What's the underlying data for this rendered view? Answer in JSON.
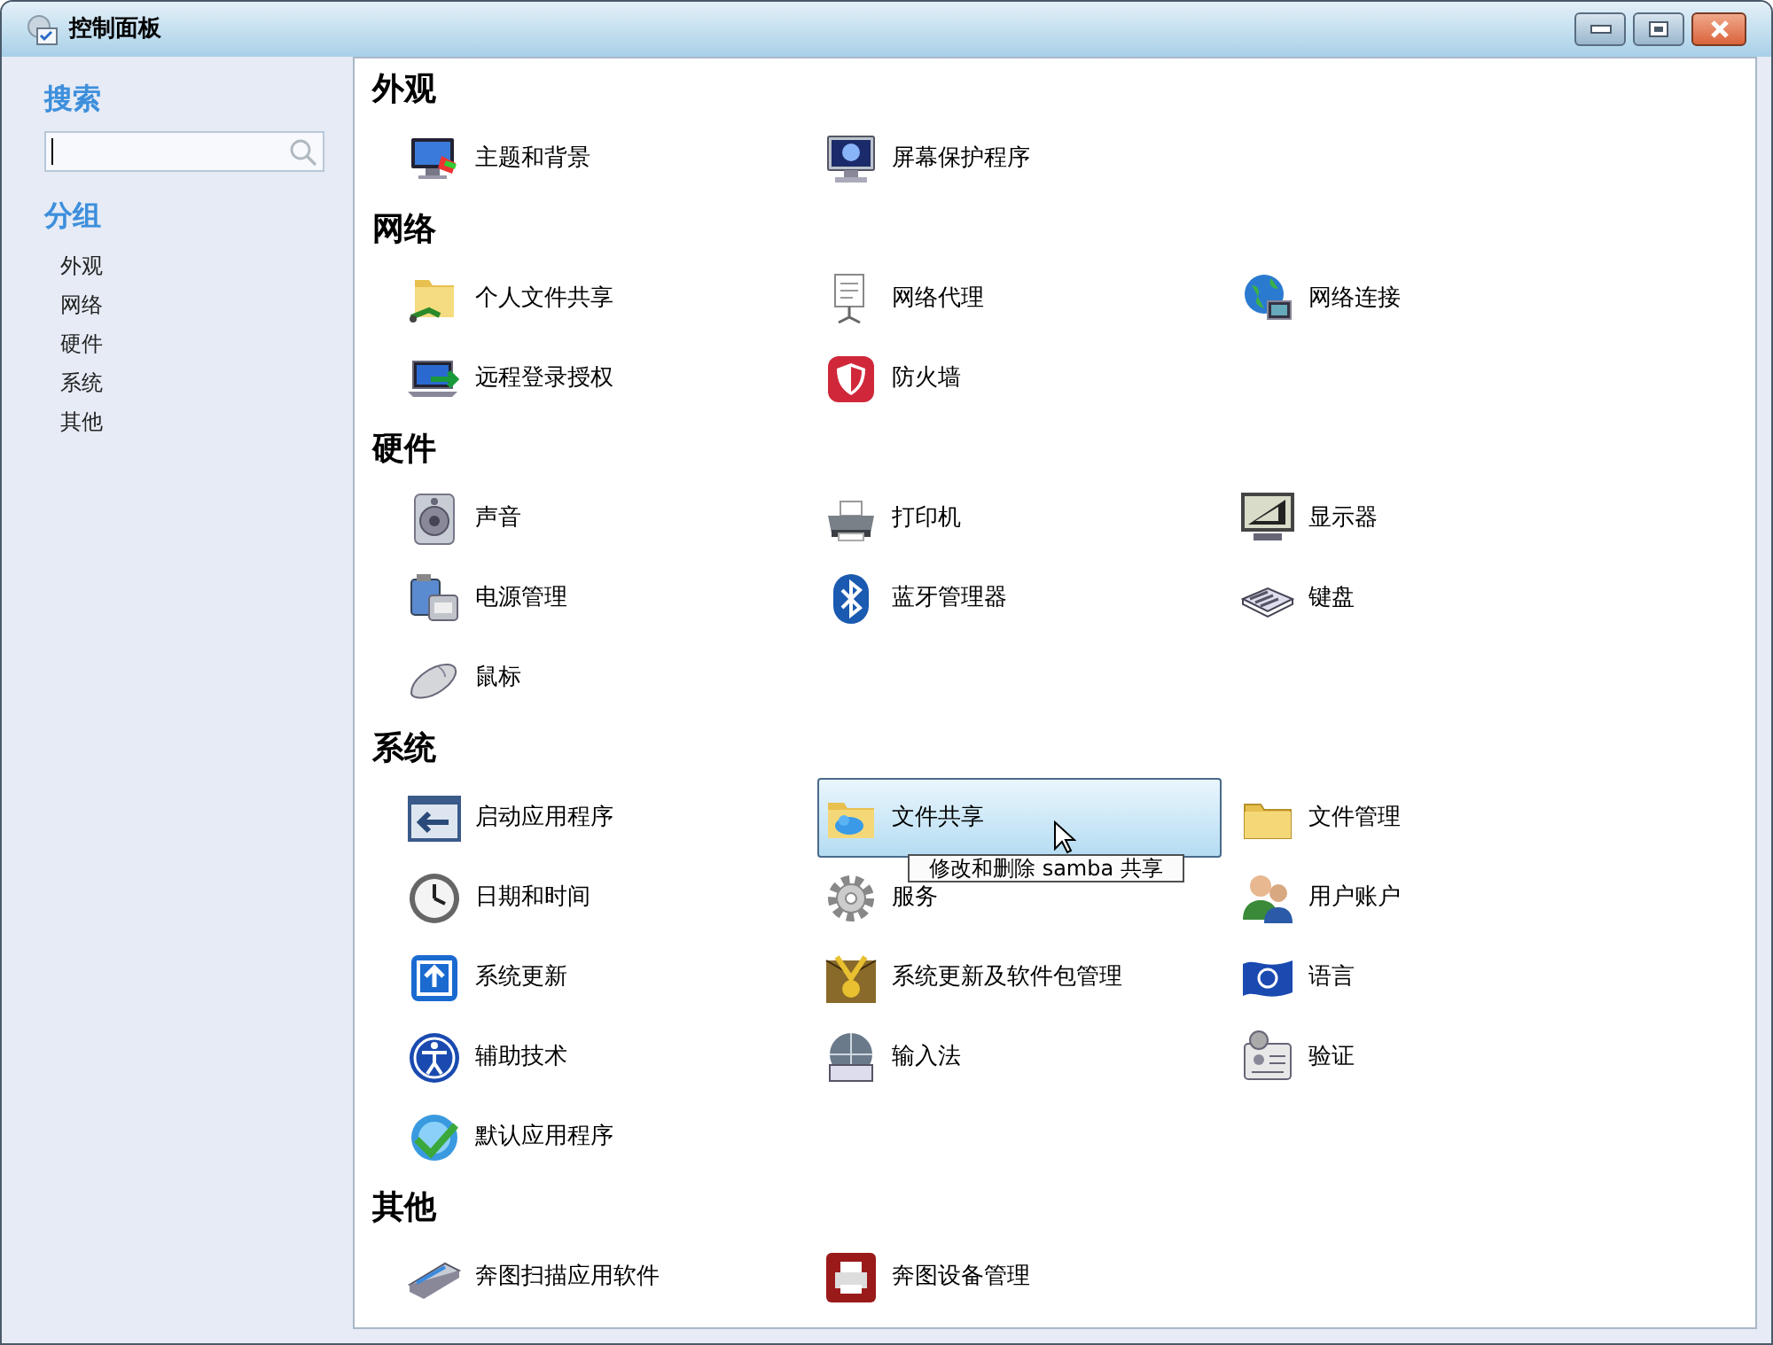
{
  "window": {
    "title": "控制面板"
  },
  "sidebar": {
    "search_heading": "搜索",
    "groups_heading": "分组",
    "groups": [
      {
        "label": "外观"
      },
      {
        "label": "网络"
      },
      {
        "label": "硬件"
      },
      {
        "label": "系统"
      },
      {
        "label": "其他"
      }
    ]
  },
  "sections": [
    {
      "title": "外观",
      "items": [
        {
          "label": "主题和背景",
          "selected": false
        },
        {
          "label": "屏幕保护程序",
          "selected": false
        }
      ]
    },
    {
      "title": "网络",
      "items": [
        {
          "label": "个人文件共享",
          "selected": false
        },
        {
          "label": "网络代理",
          "selected": false
        },
        {
          "label": "网络连接",
          "selected": false
        },
        {
          "label": "远程登录授权",
          "selected": false
        },
        {
          "label": "防火墙",
          "selected": false
        }
      ]
    },
    {
      "title": "硬件",
      "items": [
        {
          "label": "声音",
          "selected": false
        },
        {
          "label": "打印机",
          "selected": false
        },
        {
          "label": "显示器",
          "selected": false
        },
        {
          "label": "电源管理",
          "selected": false
        },
        {
          "label": "蓝牙管理器",
          "selected": false
        },
        {
          "label": "键盘",
          "selected": false
        },
        {
          "label": "鼠标",
          "selected": false
        }
      ]
    },
    {
      "title": "系统",
      "items": [
        {
          "label": "启动应用程序",
          "selected": false
        },
        {
          "label": "文件共享",
          "selected": true
        },
        {
          "label": "文件管理",
          "selected": false
        },
        {
          "label": "日期和时间",
          "selected": false
        },
        {
          "label": "服务",
          "selected": false
        },
        {
          "label": "用户账户",
          "selected": false
        },
        {
          "label": "系统更新",
          "selected": false
        },
        {
          "label": "系统更新及软件包管理",
          "selected": false
        },
        {
          "label": "语言",
          "selected": false
        },
        {
          "label": "辅助技术",
          "selected": false
        },
        {
          "label": "输入法",
          "selected": false
        },
        {
          "label": "验证",
          "selected": false
        },
        {
          "label": "默认应用程序",
          "selected": false
        }
      ]
    },
    {
      "title": "其他",
      "items": [
        {
          "label": "奔图扫描应用软件",
          "selected": false
        },
        {
          "label": "奔图设备管理",
          "selected": false
        }
      ]
    }
  ],
  "tooltip": {
    "text": "修改和删除 samba 共享"
  }
}
